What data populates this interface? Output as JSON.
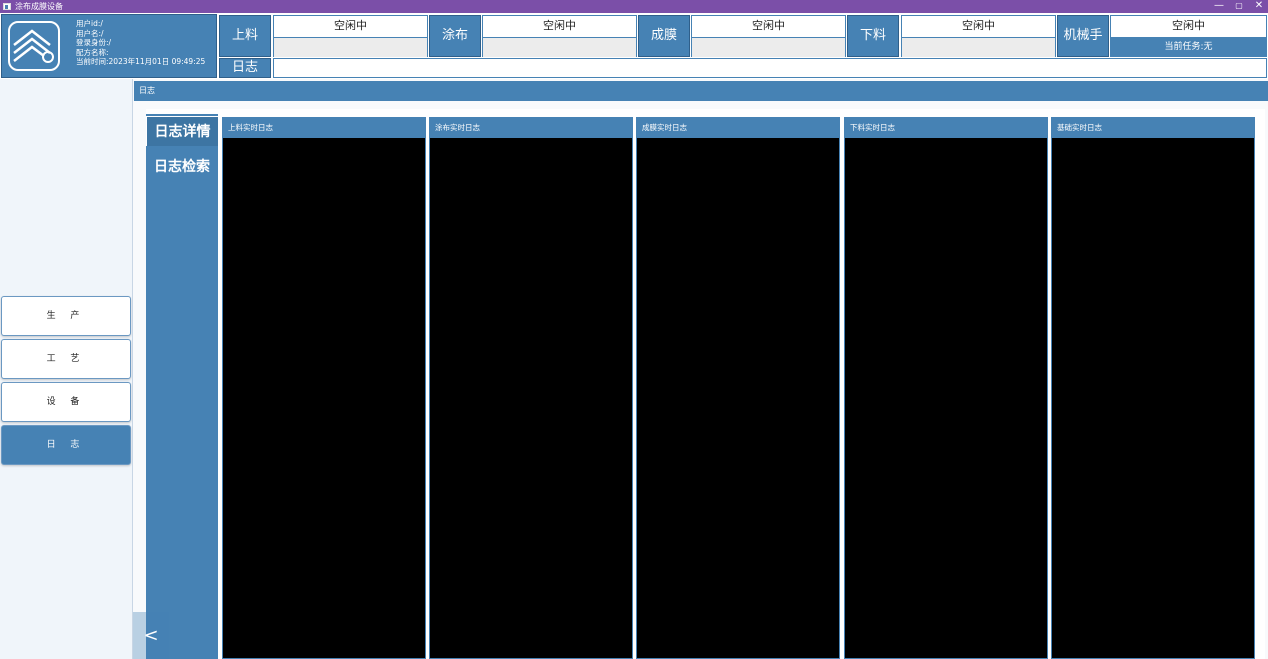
{
  "window": {
    "title": "涂布成膜设备",
    "minimize": "—",
    "restore": "▢",
    "close": "✕"
  },
  "user": {
    "user_id": "用户id:/",
    "user_name": "用户名:/",
    "login_role": "登录身份:/",
    "recipe_name": "配方名称:",
    "current_time": "当前时间:2023年11月01日 09:49:25"
  },
  "stations": [
    {
      "label": "上料",
      "status": "空闲中",
      "detail": ""
    },
    {
      "label": "涂布",
      "status": "空闲中",
      "detail": ""
    },
    {
      "label": "成膜",
      "status": "空闲中",
      "detail": ""
    },
    {
      "label": "下料",
      "status": "空闲中",
      "detail": ""
    },
    {
      "label": "机械手",
      "status": "空闲中",
      "detail": "当前任务:无"
    }
  ],
  "log_bar": {
    "label": "日志",
    "value": ""
  },
  "nav": [
    {
      "label": "生 产",
      "active": false
    },
    {
      "label": "工 艺",
      "active": false
    },
    {
      "label": "设 备",
      "active": false
    },
    {
      "label": "日 志",
      "active": true
    }
  ],
  "section_title": "日志",
  "subnav": [
    {
      "label": "日志详情",
      "active": true
    },
    {
      "label": "日志检索",
      "active": false
    }
  ],
  "log_columns": [
    {
      "title": "上料实时日志"
    },
    {
      "title": "涂布实时日志"
    },
    {
      "title": "成膜实时日志"
    },
    {
      "title": "下料实时日志"
    },
    {
      "title": "基础实时日志"
    }
  ],
  "collapse_label": "<",
  "colors": {
    "accent": "#4682b4",
    "titlebar": "#7b4fa8",
    "log_bg": "#000000"
  }
}
